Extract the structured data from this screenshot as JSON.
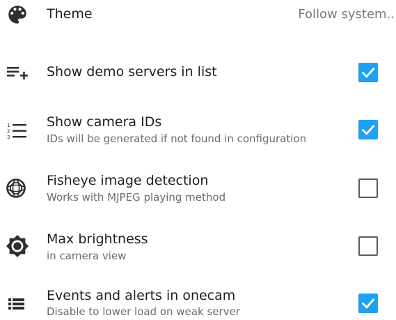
{
  "settings": {
    "theme": {
      "label": "Theme",
      "value": "Follow system..",
      "icon": "palette-icon"
    },
    "items": [
      {
        "label": "Show demo servers in list",
        "subtitle": "",
        "checked": true,
        "icon": "playlist-add-icon"
      },
      {
        "label": "Show camera IDs",
        "subtitle": "IDs will be generated if not found in configuration",
        "checked": true,
        "icon": "numbered-list-icon"
      },
      {
        "label": "Fisheye image detection",
        "subtitle": "Works with MJPEG playing method",
        "checked": false,
        "icon": "fisheye-icon"
      },
      {
        "label": "Max brightness",
        "subtitle": "in camera view",
        "checked": false,
        "icon": "brightness-icon"
      },
      {
        "label": "Events and alerts in onecam",
        "subtitle": "Disable to lower load on weak server",
        "checked": true,
        "icon": "list-icon"
      }
    ]
  },
  "colors": {
    "accent": "#1ea1f2",
    "icon": "#2e2e2e",
    "text_primary": "#202020",
    "text_secondary": "#6b6b6b"
  }
}
